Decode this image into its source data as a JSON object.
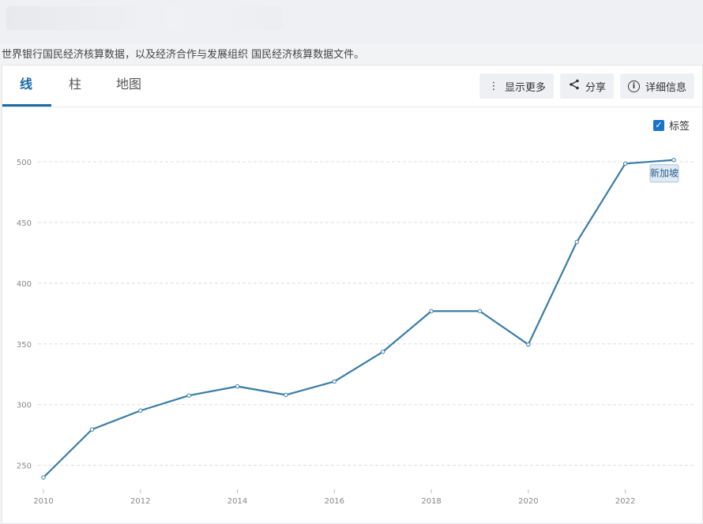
{
  "header": {
    "source_note": "世界银行国民经济核算数据，以及经济合作与发展组织 国民经济核算数据文件。"
  },
  "tabs": [
    {
      "label": "线"
    },
    {
      "label": "柱"
    },
    {
      "label": "地图"
    }
  ],
  "toolbar": {
    "more_label": "显示更多",
    "share_label": "分享",
    "details_label": "详细信息"
  },
  "label_toggle": {
    "label": "标签",
    "checked": true
  },
  "colors": {
    "line": "#3a7ca5",
    "accent": "#1c6aa8",
    "grid": "#dcdcdc"
  },
  "chart_data": {
    "type": "line",
    "title": "",
    "xlabel": "",
    "ylabel": "",
    "x": [
      2010,
      2011,
      2012,
      2013,
      2014,
      2015,
      2016,
      2017,
      2018,
      2019,
      2020,
      2021,
      2022,
      2023
    ],
    "series": [
      {
        "values": [
          240,
          279.5,
          295,
          307.5,
          315,
          308,
          319,
          343.5,
          377,
          377,
          349.5,
          434,
          498.5,
          501.5
        ]
      }
    ],
    "x_ticks": [
      "2010",
      "2012",
      "2014",
      "2016",
      "2018",
      "2020",
      "2022"
    ],
    "y_ticks": [
      "250",
      "300",
      "350",
      "400",
      "450",
      "500"
    ],
    "ylim": [
      240,
      500
    ],
    "xlim": [
      2010,
      2023
    ],
    "grid": true,
    "annotations": [
      {
        "label": "新加坡",
        "x": 2023,
        "y": 501.5
      }
    ]
  }
}
